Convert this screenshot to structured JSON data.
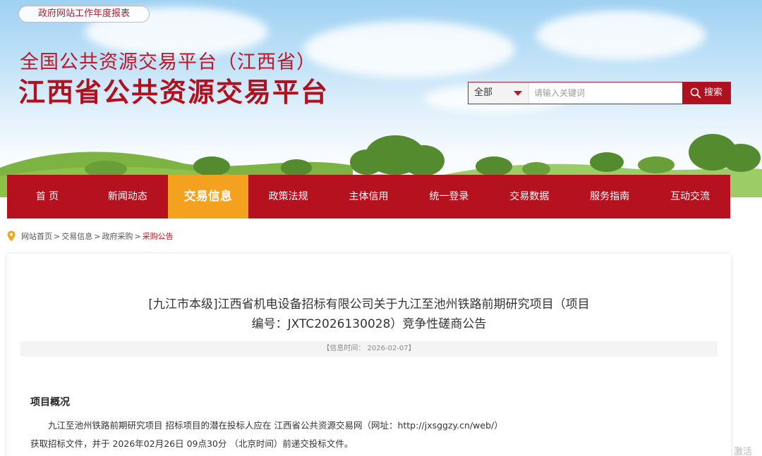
{
  "header": {
    "report_link": "政府网站工作年度报表",
    "title_line1": "全国公共资源交易平台（江西省）",
    "title_line2": "江西省公共资源交易平台"
  },
  "search": {
    "scope": "全部",
    "placeholder": "请输入关键词",
    "button": "搜索"
  },
  "nav": {
    "items": [
      "首 页",
      "新闻动态",
      "交易信息",
      "政策法规",
      "主体信用",
      "统一登录",
      "交易数据",
      "服务指南",
      "互动交流"
    ],
    "active_index": 2
  },
  "breadcrumb": {
    "items": [
      "网站首页",
      "交易信息",
      "政府采购",
      "采购公告"
    ],
    "separator": ">"
  },
  "article": {
    "title_line1": "[九江市本级]江西省机电设备招标有限公司关于九江至池州铁路前期研究项目（项目",
    "title_line2": "编号：JXTC2026130028）竞争性磋商公告",
    "info": "【信息时间： 2026-02-07】",
    "section_heading": "项目概况",
    "para1": "九江至池州铁路前期研究项目 招标项目的潜在投标人应在 江西省公共资源交易网（网址：http://jxsggzy.cn/web/）",
    "para2": "获取招标文件，并于 2026年02月26日 09点30分 （北京时间）前递交投标文件。"
  },
  "watermark": "激活 W",
  "colors": {
    "primary_red": "#b5111f",
    "active_orange": "#f4a11f",
    "title_red": "#b8192b"
  },
  "icons": {
    "search": "magnifier-icon",
    "location": "map-pin-icon",
    "dropdown": "caret-down-icon"
  }
}
